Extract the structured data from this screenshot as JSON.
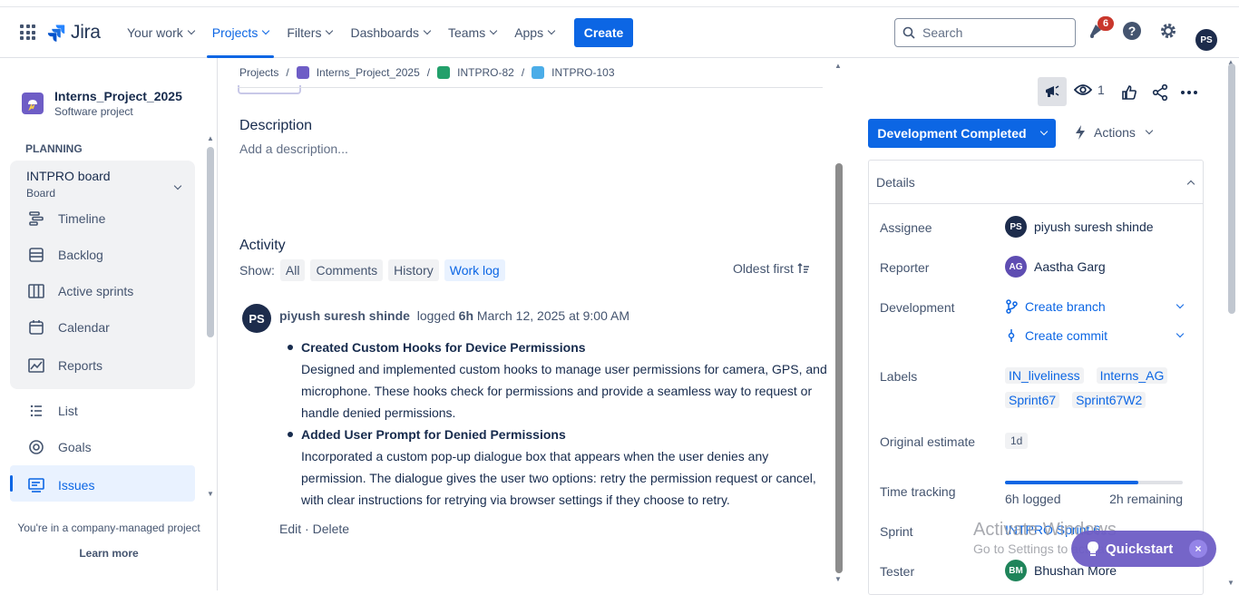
{
  "topbar": {
    "logo_text": "Jira",
    "nav": [
      {
        "label": "Your work"
      },
      {
        "label": "Projects"
      },
      {
        "label": "Filters"
      },
      {
        "label": "Dashboards"
      },
      {
        "label": "Teams"
      },
      {
        "label": "Apps"
      }
    ],
    "create_label": "Create",
    "search_placeholder": "Search",
    "notifications_count": "6",
    "user_initials": "PS"
  },
  "sidebar": {
    "project_name": "Interns_Project_2025",
    "project_type": "Software project",
    "planning_heading": "PLANNING",
    "board_title": "INTPRO board",
    "board_sub": "Board",
    "items": [
      {
        "label": "Timeline"
      },
      {
        "label": "Backlog"
      },
      {
        "label": "Active sprints"
      },
      {
        "label": "Calendar"
      },
      {
        "label": "Reports"
      },
      {
        "label": "List"
      },
      {
        "label": "Goals"
      },
      {
        "label": "Issues"
      }
    ],
    "managed_text": "You're in a company-managed project",
    "learn_more": "Learn more"
  },
  "breadcrumb": {
    "items": [
      "Projects",
      "Interns_Project_2025",
      "INTPRO-82",
      "INTPRO-103"
    ],
    "sep": "/"
  },
  "main": {
    "description_heading": "Description",
    "description_placeholder": "Add a description...",
    "activity_heading": "Activity",
    "show_label": "Show:",
    "filters": [
      "All",
      "Comments",
      "History",
      "Work log"
    ],
    "sort_label": "Oldest first",
    "log": {
      "initials": "PS",
      "author": "piyush suresh shinde",
      "logged": "logged",
      "amount": "6h",
      "date": "March 12, 2025 at 9:00 AM"
    },
    "entries": [
      {
        "title": "Created Custom Hooks for Device Permissions",
        "body": "Designed and implemented custom hooks to manage user permissions for camera, GPS, and microphone. These hooks check for permissions and provide a seamless way to request or handle denied permissions."
      },
      {
        "title": "Added User Prompt for Denied Permissions",
        "body": "Incorporated a custom pop-up dialogue box that appears when the user denies any permission. The dialogue gives the user two options: retry the permission request or cancel, with clear instructions for retrying via browser settings if they choose to retry."
      }
    ],
    "edit_label": "Edit",
    "dot": "·",
    "delete_label": "Delete"
  },
  "right": {
    "watchers": "1",
    "status": "Development Completed",
    "actions_label": "Actions",
    "details_heading": "Details",
    "assignee_label": "Assignee",
    "assignee_initials": "PS",
    "assignee_name": "piyush suresh shinde",
    "reporter_label": "Reporter",
    "reporter_initials": "AG",
    "reporter_name": "Aastha Garg",
    "development_label": "Development",
    "create_branch": "Create branch",
    "create_commit": "Create commit",
    "labels_label": "Labels",
    "labels": [
      "IN_liveliness",
      "Interns_AG",
      "Sprint67",
      "Sprint67W2"
    ],
    "estimate_label": "Original estimate",
    "estimate_value": "1d",
    "time_tracking_label": "Time tracking",
    "time_logged_fraction": 0.75,
    "time_logged": "6h logged",
    "time_remaining": "2h remaining",
    "sprint_label": "Sprint",
    "sprint_value": "INTPRO Sprint 6...",
    "tester_label": "Tester",
    "tester_initials": "BM",
    "tester_name": "Bhushan More"
  },
  "overlay": {
    "watermark_title": "Activate Windows",
    "watermark_sub": "Go to Settings to activate Windows.",
    "quickstart_label": "Quickstart",
    "quickstart_close": "×"
  },
  "colors": {
    "brand_blue": "#0c66e4",
    "nav_text": "#44546f",
    "quickstart": "#6e5dc6",
    "badge_red": "#c9372c",
    "avatar_dark": "#1d2c4c",
    "avatar_ag": "#5e4db2",
    "avatar_bm": "#1f845a"
  }
}
